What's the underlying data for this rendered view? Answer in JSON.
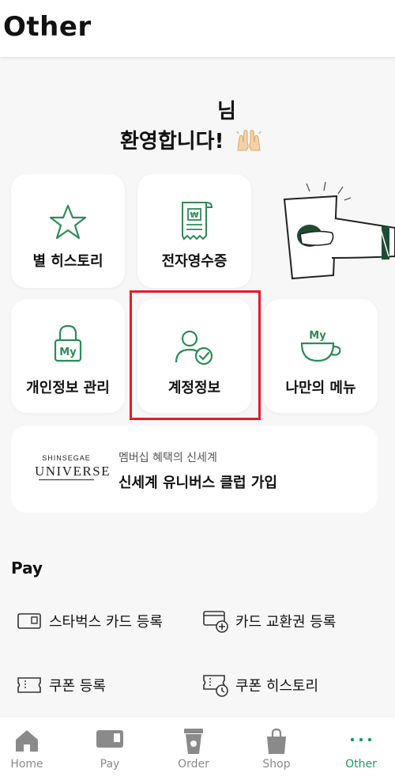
{
  "header": {
    "title": "Other"
  },
  "greeting": {
    "name_suffix": "님",
    "welcome": "환영합니다!"
  },
  "tiles": {
    "star_history": "별 히스토리",
    "e_receipt": "전자영수증",
    "personal_info": "개인정보 관리",
    "account_info": "계정정보",
    "my_menu": "나만의 메뉴"
  },
  "icons": {
    "lock_badge": "My",
    "cup_badge": "My",
    "receipt_badge": "₩"
  },
  "banner": {
    "logo_line1": "SHINSEGAE",
    "logo_line2": "UNIVERSE",
    "subtitle": "멤버십 혜택의 신세계",
    "title": "신세계 유니버스 클럽 가입"
  },
  "pay": {
    "section_title": "Pay",
    "items": [
      {
        "label": "스타벅스 카드 등록"
      },
      {
        "label": "카드 교환권 등록"
      },
      {
        "label": "쿠폰 등록"
      },
      {
        "label": "쿠폰 히스토리"
      }
    ]
  },
  "tabbar": {
    "items": [
      {
        "label": "Home"
      },
      {
        "label": "Pay"
      },
      {
        "label": "Order"
      },
      {
        "label": "Shop"
      },
      {
        "label": "Other"
      }
    ]
  },
  "colors": {
    "accent_green": "#1c9a5b",
    "icon_green": "#2e8b57",
    "highlight_red": "#e01e2a",
    "tab_gray": "#8a8a8a"
  }
}
